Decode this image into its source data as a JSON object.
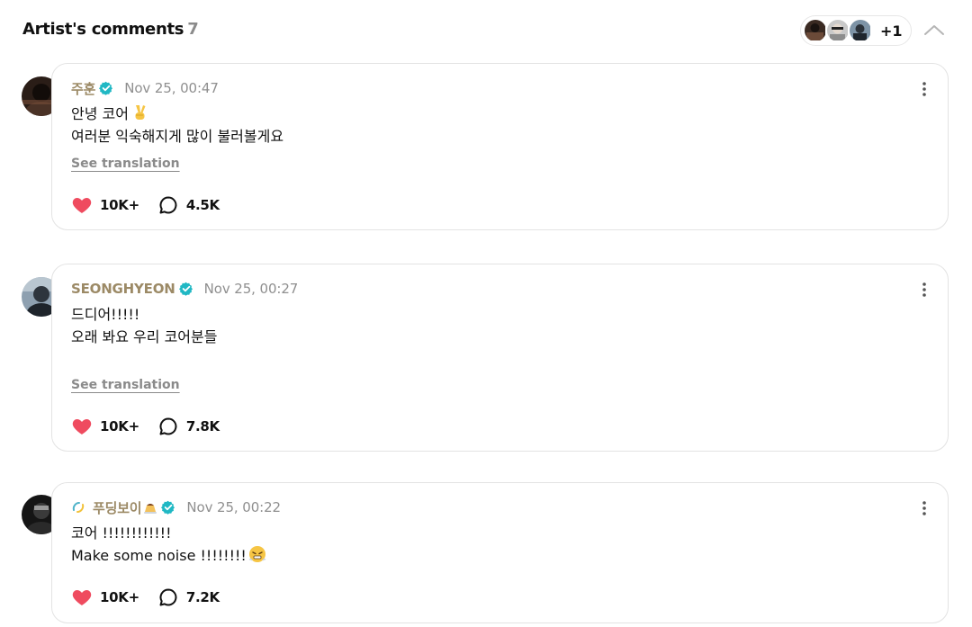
{
  "header": {
    "title": "Artist's comments",
    "count": "7",
    "more_label": "+1"
  },
  "comments": [
    {
      "author": "주훈",
      "timestamp": "Nov 25, 00:47",
      "lines": [
        "안녕 코어",
        "여러분 익숙해지게 많이 불러볼게요"
      ],
      "see_translation": "See translation",
      "likes": "10K+",
      "replies": "4.5K"
    },
    {
      "author": "SEONGHYEON",
      "timestamp": "Nov 25, 00:27",
      "lines": [
        "드디어!!!!!",
        "오래 봐요 우리 코어분들"
      ],
      "see_translation": "See translation",
      "likes": "10K+",
      "replies": "7.8K"
    },
    {
      "author": "푸딩보이",
      "timestamp": "Nov 25, 00:22",
      "lines": [
        "코어 !!!!!!!!!!!!",
        "Make some noise !!!!!!!!"
      ],
      "likes": "10K+",
      "replies": "7.2K"
    }
  ],
  "colors": {
    "author": "#9c8a66",
    "verified": "#20b8c4",
    "like": "#ef4b5f",
    "muted": "#8f8f8f"
  },
  "icons": [
    "chevron-up-icon",
    "verified-badge-icon",
    "more-vertical-icon",
    "heart-icon",
    "comment-bubble-icon",
    "victory-hand-emoji",
    "pudding-emoji",
    "sparkle-emoji",
    "steam-face-emoji"
  ]
}
